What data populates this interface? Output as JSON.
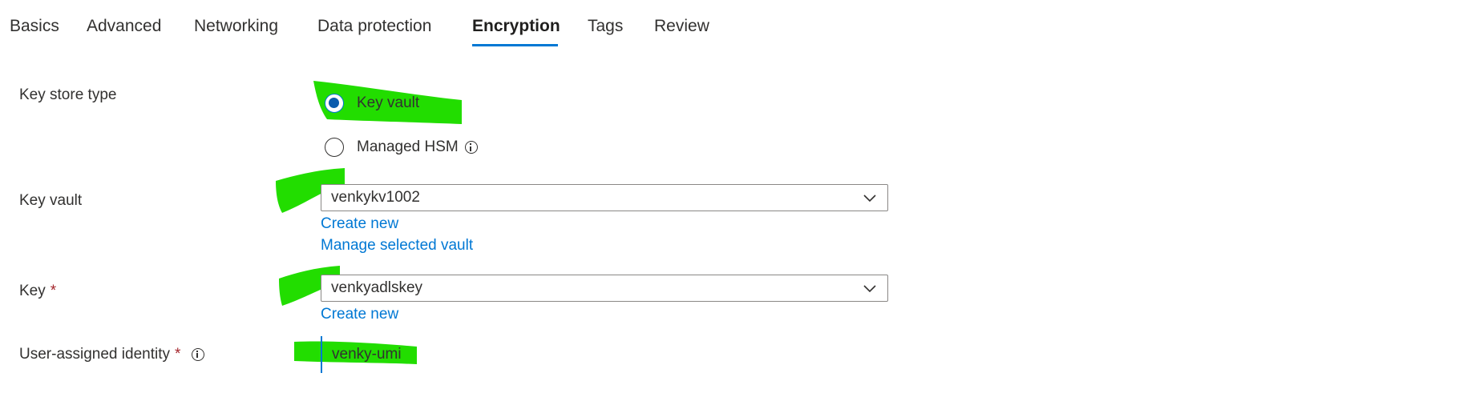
{
  "tabs": [
    {
      "label": "Basics"
    },
    {
      "label": "Advanced"
    },
    {
      "label": "Networking"
    },
    {
      "label": "Data protection"
    },
    {
      "label": "Encryption"
    },
    {
      "label": "Tags"
    },
    {
      "label": "Review"
    }
  ],
  "active_tab": "Encryption",
  "form": {
    "key_store_type": {
      "label": "Key store type",
      "options": [
        {
          "label": "Key vault",
          "checked": true
        },
        {
          "label": "Managed HSM",
          "checked": false
        }
      ]
    },
    "key_vault": {
      "label": "Key vault",
      "value": "venkykv1002",
      "create_new": "Create new",
      "manage": "Manage selected vault"
    },
    "key": {
      "label": "Key",
      "required": "*",
      "value": "venkyadlskey",
      "create_new": "Create new"
    },
    "identity": {
      "label": "User-assigned identity",
      "required": "*",
      "value": "venky-umi"
    }
  },
  "colors": {
    "accent": "#0078d4",
    "required": "#a4262c",
    "highlight": "#22dd00"
  }
}
